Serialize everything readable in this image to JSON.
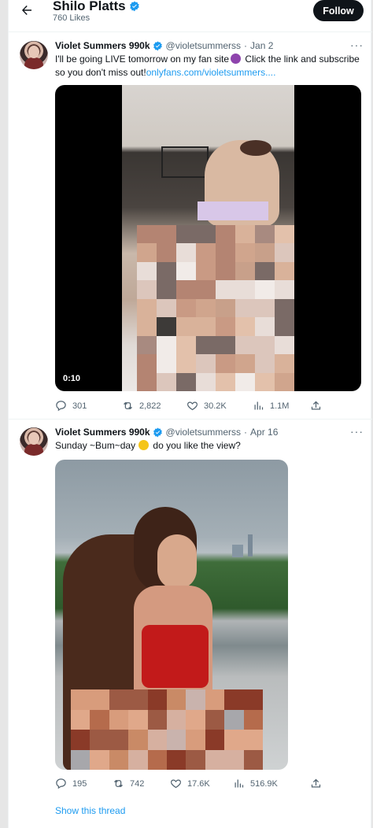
{
  "header": {
    "name": "Shilo Platts",
    "likes": "760 Likes",
    "follow_label": "Follow"
  },
  "tweets": [
    {
      "name": "Violet Summers 990k",
      "handle": "@violetsummerss",
      "sep": "·",
      "date": "Jan 2",
      "text_before_emoji": "I'll be going LIVE tomorrow on my fan site",
      "emoji": "smiling-devil-emoji",
      "text_after_emoji": " Click the link and subscribe so you don't miss out!",
      "link": "onlyfans.com/violetsummers....",
      "media_type": "video",
      "video_time": "0:10",
      "stats": {
        "replies": "301",
        "reposts": "2,822",
        "likes": "30.2K",
        "views": "1.1M"
      }
    },
    {
      "name": "Violet Summers 990k",
      "handle": "@violetsummerss",
      "sep": "·",
      "date": "Apr 16",
      "text_before_emoji": "Sunday ~Bum~day",
      "emoji": "winking-tongue-emoji",
      "text_after_emoji": " do you like the view?",
      "media_type": "photo",
      "stats": {
        "replies": "195",
        "reposts": "742",
        "likes": "17.6K",
        "views": "516.9K"
      }
    }
  ],
  "show_thread": "Show this thread",
  "colors": {
    "accent": "#1d9bf0",
    "text": "#0f1419",
    "muted": "#536471",
    "follow_bg": "#0f1419"
  }
}
